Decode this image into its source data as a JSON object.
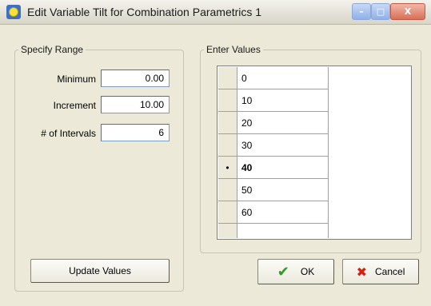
{
  "window": {
    "title": "Edit Variable Tilt for Combination Parametrics 1",
    "minimize_glyph": "–",
    "maximize_glyph": "□",
    "close_glyph": "X"
  },
  "specify_range": {
    "legend": "Specify Range",
    "minimum_label": "Minimum",
    "minimum_value": "0.00",
    "increment_label": "Increment",
    "increment_value": "10.00",
    "intervals_label": "# of Intervals",
    "intervals_value": "6",
    "update_button": "Update Values"
  },
  "enter_values": {
    "legend": "Enter Values",
    "rows": [
      {
        "marker": "",
        "value": "0"
      },
      {
        "marker": "",
        "value": "10"
      },
      {
        "marker": "",
        "value": "20"
      },
      {
        "marker": "",
        "value": "30"
      },
      {
        "marker": "•",
        "value": "40"
      },
      {
        "marker": "",
        "value": "50"
      },
      {
        "marker": "",
        "value": "60"
      },
      {
        "marker": "",
        "value": ""
      }
    ],
    "selected_row": 4
  },
  "buttons": {
    "ok": "OK",
    "cancel": "Cancel",
    "ok_icon_glyph": "✔",
    "cancel_icon_glyph": "✖"
  },
  "colors": {
    "ok_icon": "#2e9a1e",
    "cancel_icon": "#d81e12",
    "dialog_bg": "#ece9d8"
  }
}
